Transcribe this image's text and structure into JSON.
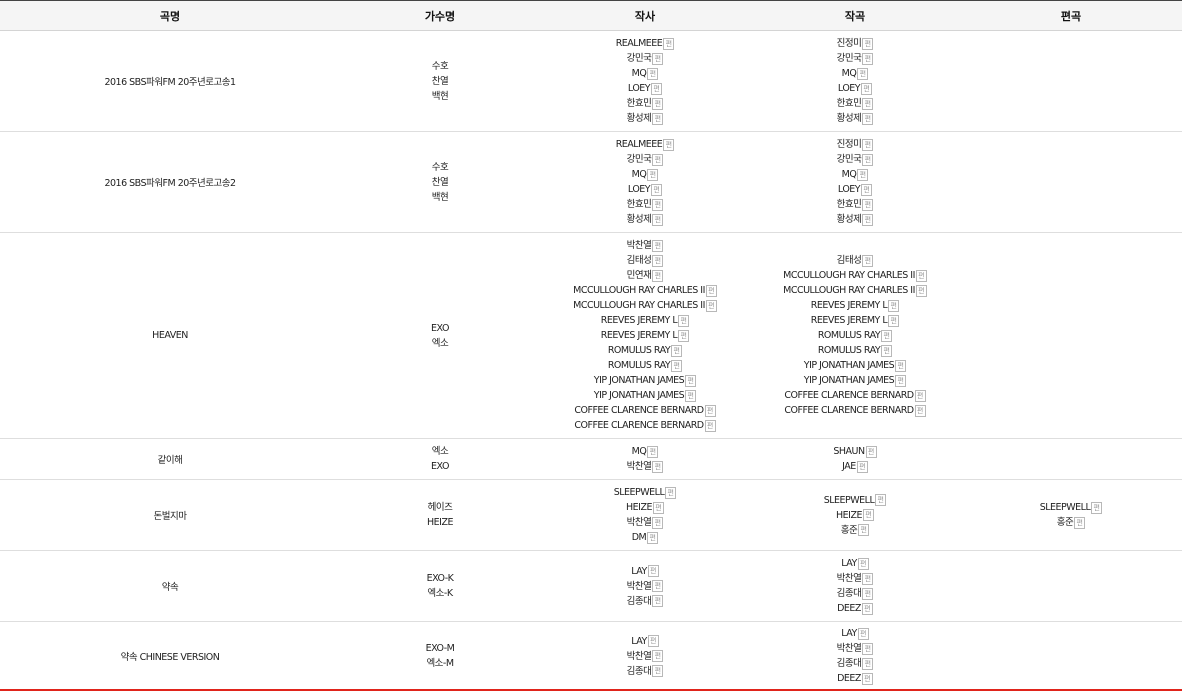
{
  "columns": [
    "곡명",
    "가수명",
    "작사",
    "작곡",
    "편곡"
  ],
  "badge_label": "편",
  "colors": {
    "bottom_rule": "#e0241b",
    "header_bg": "#f5f5f5"
  },
  "rows": [
    {
      "title": "2016 SBS파워FM 20주년로고송1",
      "artists": [
        "수호",
        "찬열",
        "백현"
      ],
      "lyricists": [
        "REALMEEE",
        "강민국",
        "MQ",
        "LOEY",
        "한효민",
        "황성제"
      ],
      "composers": [
        "진정미",
        "강민국",
        "MQ",
        "LOEY",
        "한효민",
        "황성제"
      ],
      "arrangers": []
    },
    {
      "title": "2016 SBS파워FM 20주년로고송2",
      "artists": [
        "수호",
        "찬열",
        "백현"
      ],
      "lyricists": [
        "REALMEEE",
        "강민국",
        "MQ",
        "LOEY",
        "한효민",
        "황성제"
      ],
      "composers": [
        "진정미",
        "강민국",
        "MQ",
        "LOEY",
        "한효민",
        "황성제"
      ],
      "arrangers": []
    },
    {
      "title": "HEAVEN",
      "artists": [
        "EXO",
        "엑소"
      ],
      "lyricists": [
        "박찬열",
        "김태성",
        "민연재",
        "MCCULLOUGH RAY CHARLES II",
        "MCCULLOUGH RAY CHARLES II",
        "REEVES JEREMY L",
        "REEVES JEREMY L",
        "ROMULUS RAY",
        "ROMULUS RAY",
        "YIP JONATHAN JAMES",
        "YIP JONATHAN JAMES",
        "COFFEE CLARENCE BERNARD",
        "COFFEE CLARENCE BERNARD"
      ],
      "composers": [
        "김태성",
        "MCCULLOUGH RAY CHARLES II",
        "MCCULLOUGH RAY CHARLES II",
        "REEVES JEREMY L",
        "REEVES JEREMY L",
        "ROMULUS RAY",
        "ROMULUS RAY",
        "YIP JONATHAN JAMES",
        "YIP JONATHAN JAMES",
        "COFFEE CLARENCE BERNARD",
        "COFFEE CLARENCE BERNARD"
      ],
      "arrangers": []
    },
    {
      "title": "같이해",
      "artists": [
        "엑소",
        "EXO"
      ],
      "lyricists": [
        "MQ",
        "박찬열"
      ],
      "composers": [
        "SHAUN",
        "JAE"
      ],
      "arrangers": []
    },
    {
      "title": "돈벌지마",
      "artists": [
        "헤이즈",
        "HEIZE"
      ],
      "lyricists": [
        "SLEEPWELL",
        "HEIZE",
        "박찬열",
        "DM"
      ],
      "composers": [
        "SLEEPWELL",
        "HEIZE",
        "홍준"
      ],
      "arrangers": [
        "SLEEPWELL",
        "홍준"
      ]
    },
    {
      "title": "약속",
      "artists": [
        "EXO-K",
        "엑소-K"
      ],
      "lyricists": [
        "LAY",
        "박찬열",
        "김종대"
      ],
      "composers": [
        "LAY",
        "박찬열",
        "김종대",
        "DEEZ"
      ],
      "arrangers": []
    },
    {
      "title": "약속 CHINESE VERSION",
      "artists": [
        "EXO-M",
        "엑소-M"
      ],
      "lyricists": [
        "LAY",
        "박찬열",
        "김종대"
      ],
      "composers": [
        "LAY",
        "박찬열",
        "김종대",
        "DEEZ"
      ],
      "arrangers": []
    }
  ]
}
